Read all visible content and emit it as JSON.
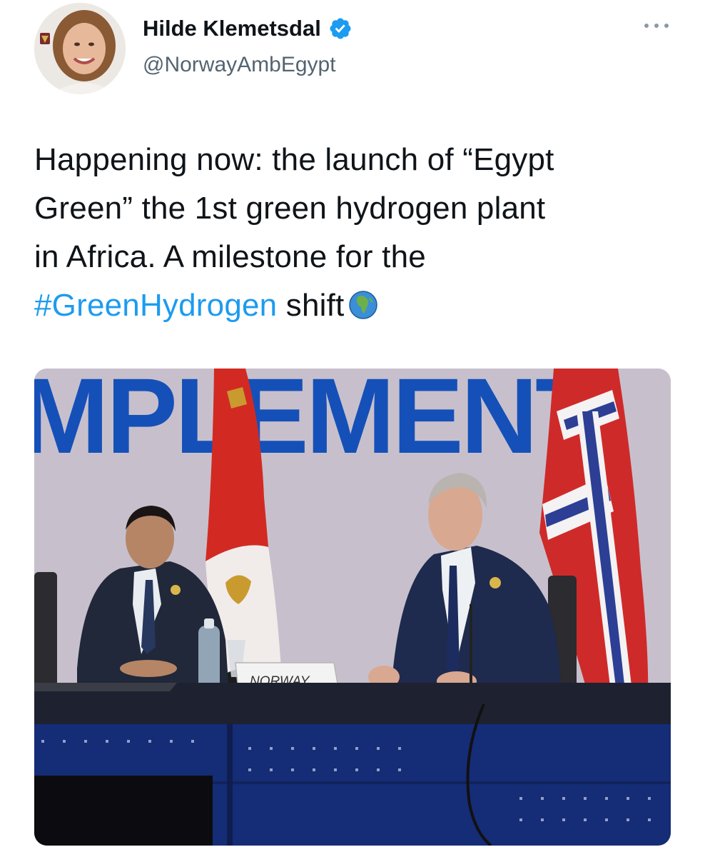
{
  "author": {
    "name": "Hilde Klemetsdal",
    "handle": "@NorwayAmbEgypt",
    "verified": true,
    "avatar_icon": "profile-photo"
  },
  "menu": {
    "icon": "more-horizontal-icon"
  },
  "tweet": {
    "line1": "Happening now: the launch of “Egypt",
    "line2": "Green” the 1st green hydrogen plant",
    "line3": "in Africa. A milestone for the",
    "hashtag": "#GreenHydrogen",
    "line4_rest": "shift",
    "emoji": "globe-africa-icon"
  },
  "photo": {
    "banner_text": "MPLEMENT",
    "nameplate": "NORWAY"
  },
  "colors": {
    "text": "#0f1419",
    "secondary": "#536471",
    "link": "#1d9bf0",
    "verified": "#1d9bf0"
  }
}
